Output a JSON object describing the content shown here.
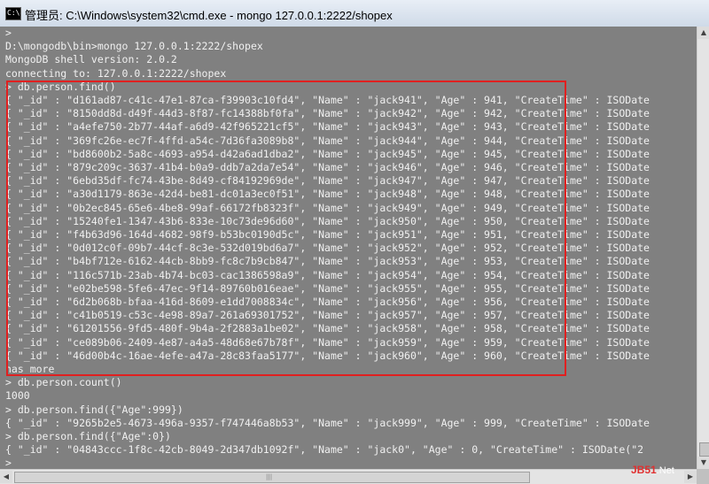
{
  "window": {
    "icon_text": "C:\\",
    "title": "管理员: C:\\Windows\\system32\\cmd.exe - mongo  127.0.0.1:2222/shopex"
  },
  "console_lines": [
    ">",
    "D:\\mongodb\\bin>mongo 127.0.0.1:2222/shopex",
    "MongoDB shell version: 2.0.2",
    "connecting to: 127.0.0.1:2222/shopex",
    "> db.person.find()",
    "{ \"_id\" : \"d161ad87-c41c-47e1-87ca-f39903c10fd4\", \"Name\" : \"jack941\", \"Age\" : 941, \"CreateTime\" : ISODate",
    "{ \"_id\" : \"8150dd8d-d49f-44d3-8f87-fc14388bf0fa\", \"Name\" : \"jack942\", \"Age\" : 942, \"CreateTime\" : ISODate",
    "{ \"_id\" : \"a4efe750-2b77-44af-a6d9-42f965221cf5\", \"Name\" : \"jack943\", \"Age\" : 943, \"CreateTime\" : ISODate",
    "{ \"_id\" : \"369fc26e-ec7f-4ffd-a54c-7d36fa3089b8\", \"Name\" : \"jack944\", \"Age\" : 944, \"CreateTime\" : ISODate",
    "{ \"_id\" : \"bd8600b2-5a8c-4693-a954-d42a6ad1dba2\", \"Name\" : \"jack945\", \"Age\" : 945, \"CreateTime\" : ISODate",
    "{ \"_id\" : \"879c209c-3637-41b4-b0a9-ddb7a2da7e54\", \"Name\" : \"jack946\", \"Age\" : 946, \"CreateTime\" : ISODate",
    "{ \"_id\" : \"6ebd35df-fc74-43be-8d49-cf84192969de\", \"Name\" : \"jack947\", \"Age\" : 947, \"CreateTime\" : ISODate",
    "{ \"_id\" : \"a30d1179-863e-42d4-be81-dc01a3ec0f51\", \"Name\" : \"jack948\", \"Age\" : 948, \"CreateTime\" : ISODate",
    "{ \"_id\" : \"0b2ec845-65e6-4be8-99af-66172fb8323f\", \"Name\" : \"jack949\", \"Age\" : 949, \"CreateTime\" : ISODate",
    "{ \"_id\" : \"15240fe1-1347-43b6-833e-10c73de96d60\", \"Name\" : \"jack950\", \"Age\" : 950, \"CreateTime\" : ISODate",
    "{ \"_id\" : \"f4b63d96-164d-4682-98f9-b53bc0190d5c\", \"Name\" : \"jack951\", \"Age\" : 951, \"CreateTime\" : ISODate",
    "{ \"_id\" : \"0d012c0f-09b7-44cf-8c3e-532d019bd6a7\", \"Name\" : \"jack952\", \"Age\" : 952, \"CreateTime\" : ISODate",
    "{ \"_id\" : \"b4bf712e-6162-44cb-8bb9-fc8c7b9cb847\", \"Name\" : \"jack953\", \"Age\" : 953, \"CreateTime\" : ISODate",
    "{ \"_id\" : \"116c571b-23ab-4b74-bc03-cac1386598a9\", \"Name\" : \"jack954\", \"Age\" : 954, \"CreateTime\" : ISODate",
    "{ \"_id\" : \"e02be598-5fe6-47ec-9f14-89760b016eae\", \"Name\" : \"jack955\", \"Age\" : 955, \"CreateTime\" : ISODate",
    "{ \"_id\" : \"6d2b068b-bfaa-416d-8609-e1dd7008834c\", \"Name\" : \"jack956\", \"Age\" : 956, \"CreateTime\" : ISODate",
    "{ \"_id\" : \"c41b0519-c53c-4e98-89a7-261a69301752\", \"Name\" : \"jack957\", \"Age\" : 957, \"CreateTime\" : ISODate",
    "{ \"_id\" : \"61201556-9fd5-480f-9b4a-2f2883a1be02\", \"Name\" : \"jack958\", \"Age\" : 958, \"CreateTime\" : ISODate",
    "{ \"_id\" : \"ce089b06-2409-4e87-a4a5-48d68e67b78f\", \"Name\" : \"jack959\", \"Age\" : 959, \"CreateTime\" : ISODate",
    "{ \"_id\" : \"46d00b4c-16ae-4efe-a47a-28c83faa5177\", \"Name\" : \"jack960\", \"Age\" : 960, \"CreateTime\" : ISODate",
    "has more",
    "> db.person.count()",
    "1000",
    "> db.person.find({\"Age\":999})",
    "{ \"_id\" : \"9265b2e5-4673-496a-9357-f747446a8b53\", \"Name\" : \"jack999\", \"Age\" : 999, \"CreateTime\" : ISODate",
    "> db.person.find({\"Age\":0})",
    "{ \"_id\" : \"04843ccc-1f8c-42cb-8049-2d347db1092f\", \"Name\" : \"jack0\", \"Age\" : 0, \"CreateTime\" : ISODate(\"2",
    ">"
  ],
  "watermark": {
    "brand": "JB51",
    "suffix": ".Net"
  }
}
